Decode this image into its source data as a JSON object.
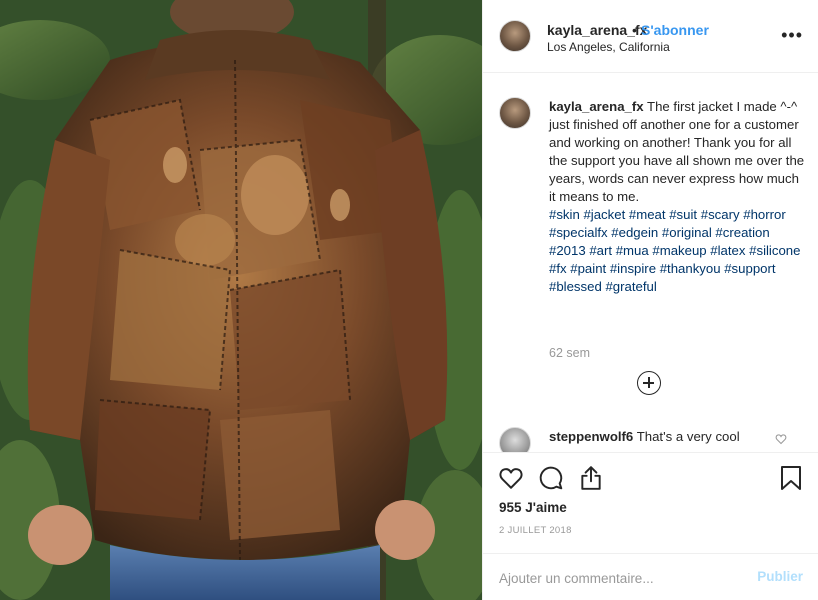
{
  "post": {
    "username": "kayla_arena_fx",
    "separator": "•",
    "follow_label": "S'abonner",
    "location": "Los Angeles, California",
    "more_label": "•••",
    "caption_text": "The first jacket I made ^-^ just finished off another one for a customer and working on another! Thank you for all the support you have all shown me over the years, words can never express how much it means to me.",
    "hashtags": "#skin #jacket #meat #suit #scary #horror #specialfx #edgein #original #creation #2013 #art #mua #makeup #latex #silicone #fx #paint #inspire #thankyou #support #blessed #grateful",
    "time_ago": "62 sem",
    "likes_count": "955",
    "likes_label": "J'aime",
    "date": "2 JUILLET 2018"
  },
  "comment": {
    "username": "steppenwolf6",
    "text": "That's a very cool"
  },
  "add_comment": {
    "placeholder": "Ajouter un commentaire...",
    "publish_label": "Publier"
  },
  "icons": {
    "like": "heart-icon",
    "comment": "comment-icon",
    "share": "share-icon",
    "save": "bookmark-icon",
    "load_more": "plus-circle-icon",
    "comment_like": "heart-icon"
  },
  "colors": {
    "link": "#3897f0",
    "hashtag": "#003569",
    "muted": "#999999",
    "publish_disabled": "#b2dffc"
  }
}
